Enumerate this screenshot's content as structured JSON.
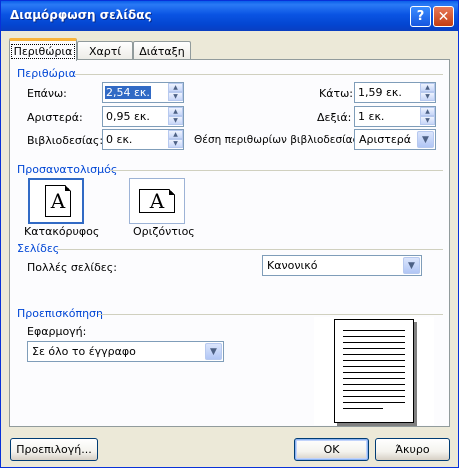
{
  "window": {
    "title": "Διαμόρφωση σελίδας"
  },
  "titlebar": {
    "help_label": "?",
    "close_label": "✕"
  },
  "tabs": [
    {
      "label": "Περιθώρια",
      "active": true
    },
    {
      "label": "Χαρτί",
      "active": false
    },
    {
      "label": "Διάταξη",
      "active": false
    }
  ],
  "margins": {
    "group_title": "Περιθώρια",
    "top": {
      "label": "Επάνω:",
      "value": "2,54 εκ."
    },
    "left": {
      "label": "Αριστερά:",
      "value": "0,95 εκ."
    },
    "gutter": {
      "label": "Βιβλιοδεσίας:",
      "value": "0 εκ."
    },
    "bottom": {
      "label": "Κάτω:",
      "value": "1,59 εκ."
    },
    "right": {
      "label": "Δεξιά:",
      "value": "1 εκ."
    },
    "gutter_position": {
      "label": "Θέση περιθωρίων βιβλιοδεσίας:",
      "value": "Αριστερά"
    }
  },
  "orientation": {
    "group_title": "Προσανατολισμός",
    "portrait": {
      "label": "Κατακόρυφος",
      "glyph": "A",
      "selected": true
    },
    "landscape": {
      "label": "Οριζόντιος",
      "glyph": "A",
      "selected": false
    }
  },
  "pages": {
    "group_title": "Σελίδες",
    "multiple_label": "Πολλές σελίδες:",
    "multiple_value": "Κανονικό"
  },
  "preview": {
    "group_title": "Προεπισκόπηση",
    "apply_label": "Εφαρμογή:",
    "apply_value": "Σε όλο το έγγραφο"
  },
  "buttons": {
    "default": "Προεπιλογή...",
    "ok": "OK",
    "cancel": "Άκυρο"
  },
  "icons": {
    "spin_up": "▲",
    "spin_down": "▼",
    "dropdown": "▼"
  }
}
